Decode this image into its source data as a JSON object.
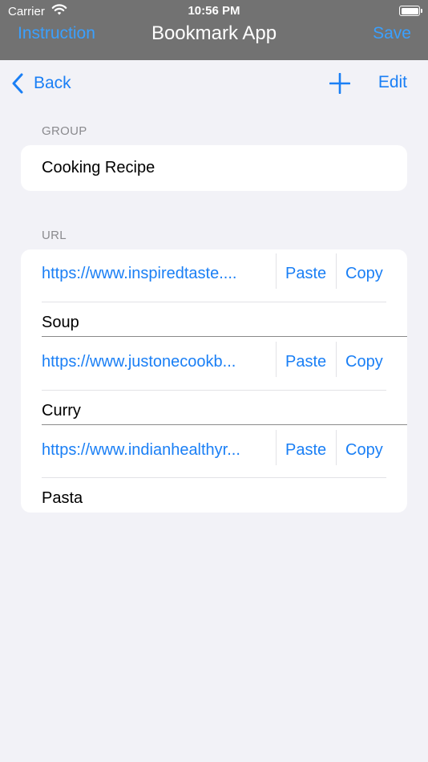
{
  "status": {
    "carrier": "Carrier",
    "time": "10:56 PM"
  },
  "nav": {
    "left": "Instruction",
    "title": "Bookmark App",
    "right": "Save"
  },
  "toolbar": {
    "back": "Back",
    "edit": "Edit"
  },
  "group": {
    "label": "GROUP",
    "value": "Cooking Recipe"
  },
  "urls": {
    "label": "URL",
    "items": [
      {
        "url": "https://www.inspiredtaste....",
        "paste": "Paste",
        "copy": "Copy",
        "name": "Soup"
      },
      {
        "url": "https://www.justonecookb...",
        "paste": "Paste",
        "copy": "Copy",
        "name": "Curry"
      },
      {
        "url": "https://www.indianhealthyr...",
        "paste": "Paste",
        "copy": "Copy",
        "name": "Pasta"
      }
    ]
  },
  "colors": {
    "accent": "#1a7ff5",
    "navbar": "#727272",
    "background": "#f2f2f7"
  }
}
